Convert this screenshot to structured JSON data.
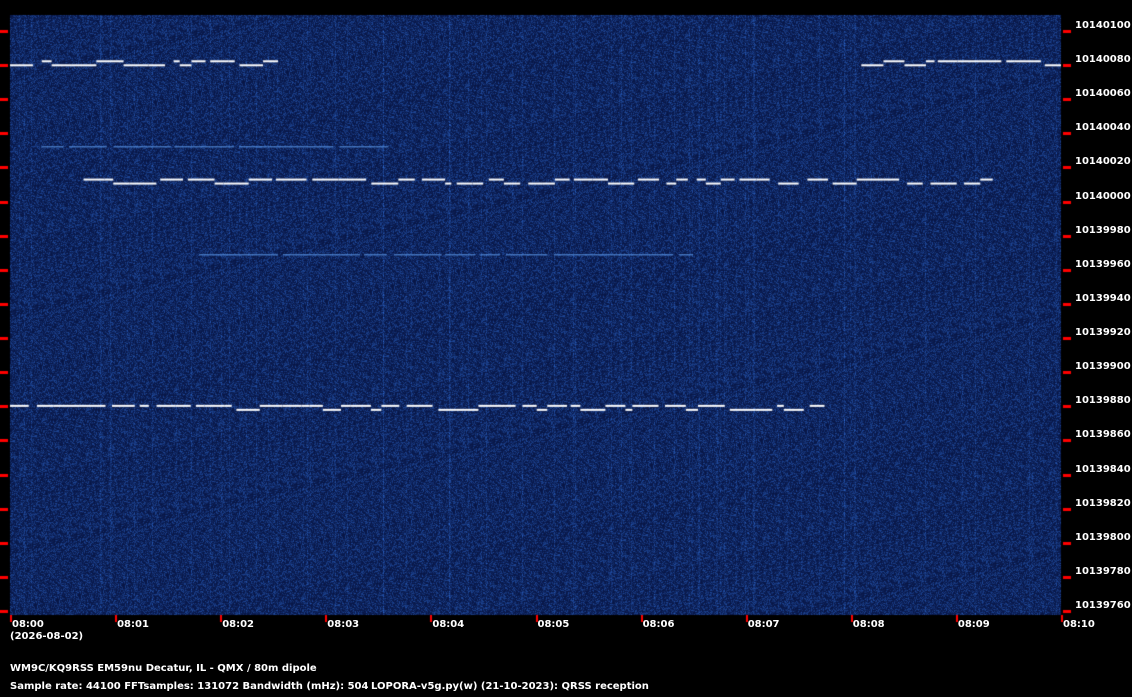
{
  "chart_data": {
    "type": "heatmap",
    "x_tick_labels": [
      "08:00",
      "08:01",
      "08:02",
      "08:03",
      "08:04",
      "08:05",
      "08:06",
      "08:07",
      "08:08",
      "08:09",
      "08:10"
    ],
    "y_tick_labels": [
      "10140100",
      "10140080",
      "10140060",
      "10140040",
      "10140020",
      "10140000",
      "10139980",
      "10139960",
      "10139940",
      "10139920",
      "10139900",
      "10139880",
      "10139860",
      "10139840",
      "10139820",
      "10139800",
      "10139780",
      "10139760"
    ],
    "xlim": [
      "08:00",
      "08:10"
    ],
    "ylim": [
      10139755,
      10140105
    ],
    "date_label": "(2026-08-02)",
    "colors": {
      "background": "#0a1a4a",
      "tick": "#ff0000",
      "signal": "#ffffff"
    },
    "signals": [
      {
        "freq": 10140078,
        "start_min": 0.0,
        "end_min": 2.55
      },
      {
        "freq": 10140078,
        "start_min": 8.1,
        "end_min": 10.0
      },
      {
        "freq": 10140009,
        "start_min": 0.7,
        "end_min": 9.35
      },
      {
        "freq": 10139877,
        "start_min": 0.0,
        "end_min": 7.75
      },
      {
        "freq": 10140028,
        "start_min": 0.3,
        "end_min": 3.6
      },
      {
        "freq": 10139965,
        "start_min": 1.8,
        "end_min": 6.5
      }
    ]
  },
  "footer": {
    "station": "WM9C/KQ9RSS EM59nu Decatur, IL - QMX / 80m dipole",
    "params": "Sample rate: 44100    FFTsamples: 131072    Bandwidth (mHz): 504",
    "software": "LOPORA-v5g.py(w) (21-10-2023): QRSS reception"
  }
}
